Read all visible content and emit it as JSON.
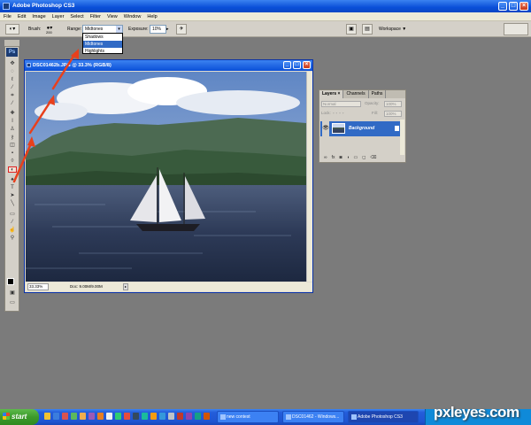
{
  "app": {
    "title": "Adobe Photoshop CS3",
    "logo_text": "Ps"
  },
  "window_controls": {
    "minimize": "_",
    "maximize": "□",
    "close": "×"
  },
  "menu": [
    "File",
    "Edit",
    "Image",
    "Layer",
    "Select",
    "Filter",
    "View",
    "Window",
    "Help"
  ],
  "options_bar": {
    "tool_icon": "dodge-tool-icon",
    "brush_label": "Brush:",
    "brush_size": "200",
    "range_label": "Range:",
    "range_value": "Midtones",
    "range_options": [
      "Shadows",
      "Midtones",
      "Highlights"
    ],
    "exposure_label": "Exposure:",
    "exposure_value": "10%",
    "workspace_label": "Workspace ▼"
  },
  "document": {
    "title": "DSC01462b.JPG @ 33.3% (RGB/8)",
    "zoom": "33.33%",
    "doc_size": "Doc: 9.00M/9.00M"
  },
  "layers_panel": {
    "tabs": [
      "Layers ×",
      "Channels",
      "Paths"
    ],
    "blend_mode": "Normal",
    "opacity_label": "Opacity:",
    "opacity_value": "100%",
    "lock_label": "Lock:",
    "fill_label": "Fill:",
    "fill_value": "100%",
    "layer_name": "Background",
    "bottom_icons": [
      "link-icon",
      "fx-icon",
      "mask-icon",
      "adjustment-icon",
      "folder-icon",
      "new-layer-icon",
      "trash-icon"
    ]
  },
  "taskbar": {
    "start_label": "start",
    "tasks": [
      "new contest",
      "DSC01462 - Windows...",
      "Adobe Photoshop CS3"
    ]
  },
  "watermark": "pxleyes.com",
  "colors": {
    "accent": "#316ac5",
    "arrow": "#e8401c",
    "xp_title": "#0a4fd8"
  }
}
